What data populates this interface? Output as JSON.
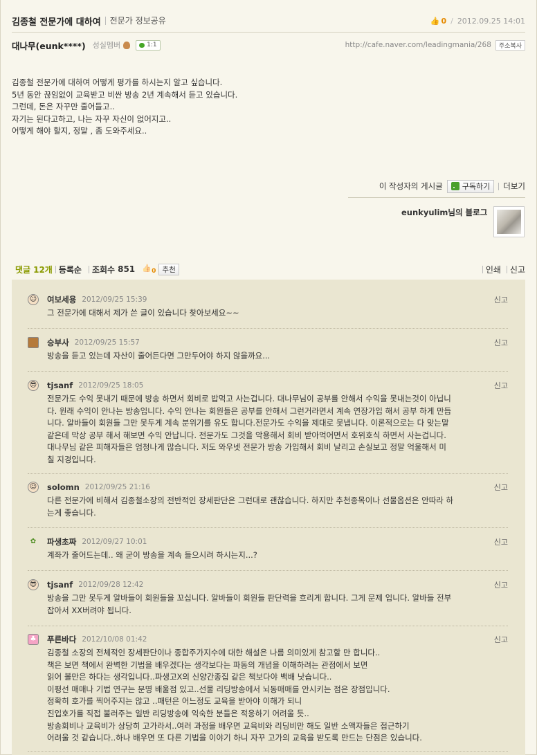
{
  "post": {
    "title": "김종철 전문가에 대하여",
    "category": "전문가 정보공유",
    "like_count": "0",
    "date": "2012.09.25 14:01",
    "author": "대나무(eunk****)",
    "author_grade": "성실멤버",
    "chat_badge": "1:1",
    "url": "http://cafe.naver.com/leadingmania/268",
    "copy_url_label": "주소복사",
    "body": [
      "김종철 전문가에 대하여 어떻게 평가를 하시는지 알고 싶습니다.",
      "5년 동안 끊임없이 교육받고 비싼 방송 2년 계속해서 듣고 있습니다.",
      "그런데, 돈은 자꾸만 줄어들고..",
      "자기는 된다고하고, 나는 자꾸 자신이 없어지고..",
      "어떻게 해야 할지, 정말  , 좀 도와주세요.."
    ]
  },
  "author_tools": {
    "posts_label": "이 작성자의 게시글",
    "subscribe_label": "구독하기",
    "more_label": "더보기"
  },
  "blog": {
    "label": "eunkyulim님의 블로그"
  },
  "comment_bar": {
    "count_label": "댓글",
    "count": "12개",
    "sort_label": "등록순",
    "views_label": "조회수",
    "views": "851",
    "like_count": "0",
    "recommend_label": "추천",
    "print_label": "인쇄",
    "report_label": "신고"
  },
  "comments": [
    {
      "name": "여보세용",
      "date": "2012/09/25 15:39",
      "report": "신고",
      "avatar": "smile-face-icon",
      "lines": [
        "그 전문가에 대해서 제가 쓴 글이 있습니다 찾아보세요~~"
      ]
    },
    {
      "name": "승부사",
      "date": "2012/09/25 15:57",
      "report": "신고",
      "avatar": "lion-icon",
      "lines": [
        "방송을 듣고 있는데 자산이 줄어든다면 그만두어야 하지 않을까요..."
      ]
    },
    {
      "name": "tjsanf",
      "date": "2012/09/25 18:05",
      "report": "신고",
      "avatar": "sunglasses-face-icon",
      "lines": [
        "전문가도 수익 못내기 때문에 방송 하면서 회비로 밥먹고 사는겁니다. 대나무님이 공부를 안해서 수익을 못내는것이 아닙니",
        "다. 원래 수익이 안나는 방송입니다. 수익 안나는 회원들은 공부를 안해서 그런거라면서 계속 연장가입 해서 공부 하게 만듭",
        "니다. 알바들이 회원들 그만 못두게 계속 분위기를 유도 합니다.전문가도 수익을 제대로 못냅니다. 이론적으로는 다 맞는말",
        "같은데 막상 공부 해서 해보면 수익 안납니다. 전문가도 그것을 악용해서 회비 받아먹어면서 호위호식 하면서 사는겁니다.",
        "대나무님 같은 피해자들은 엄청나게 많습니다. 저도 와우넷 전문가 방송 가입해서 회비 날리고 손실보고 정말 억울해서 미",
        "칠 지경입니다."
      ]
    },
    {
      "name": "solomn",
      "date": "2012/09/25 21:16",
      "report": "신고",
      "avatar": "smile-face-icon",
      "lines": [
        "다른 전문가에 비해서 김종철소장의 전반적인 장세판단은 그런대로 괜찮습니다. 하지만 추천종목이나 선물옵션은 안따라 하",
        "는게 좋습니다."
      ]
    },
    {
      "name": "파생초짜",
      "date": "2012/09/27 10:01",
      "report": "신고",
      "avatar": "sprout-icon",
      "lines": [
        "계좌가 줄어드는데.. 왜 굳이 방송을 계속 들으시려 하시는지...?"
      ]
    },
    {
      "name": "tjsanf",
      "date": "2012/09/28 12:42",
      "report": "신고",
      "avatar": "sunglasses-face-icon",
      "lines": [
        "방송을 그만 못두게 알바들이 회원들을 꼬십니다. 알바들이 회원들 판단력을 흐리게 합니다. 그게 문제 입니다. 알바들 전부",
        "잡아서 XX버려야 됩니다."
      ]
    },
    {
      "name": "푸른바다",
      "date": "2012/10/08 01:42",
      "report": "신고",
      "avatar": "pink-character-icon",
      "lines": [
        "김종철 소장의 전체적인 장세판단이나 종합주가지수에 대한 해설은 나름 의미있게 참고할 만 합니다..",
        "책은 보면 책에서 완벽한 기법을 배우겠다는 생각보다는 파동의 개념을 이해하려는 관점에서 보면",
        "읽어 볼만은 하다는 생각입니다..파생고X의 신양간종집 같은 책보다야 백배 낫습니다..",
        "이평선 매매나 기법 연구는 분명 배울점 있고..선물 리딩방송에서 뇌동매매를 안시키는 점은 장점입니다.",
        "정확히 호가를 찍어주지는 않고 ..패턴은 어느정도 교육을 받아야 이해가 되니",
        "진입호가를 직접 불러주는 일반 리딩방송에 익숙한 분들은 적응하기 어려울 듯..",
        "방송회비나 교육비가 상당히 고가라서..여러 과정을 배우면 교육비와 리딩비만 해도 일반 소액자들은 접근하기",
        "어려울 것 같습니다..하나 배우면 또 다른 기법을 이야기 하니 자꾸 고가의 교육을 받도록 만드는 단점은 있습니다."
      ]
    }
  ]
}
